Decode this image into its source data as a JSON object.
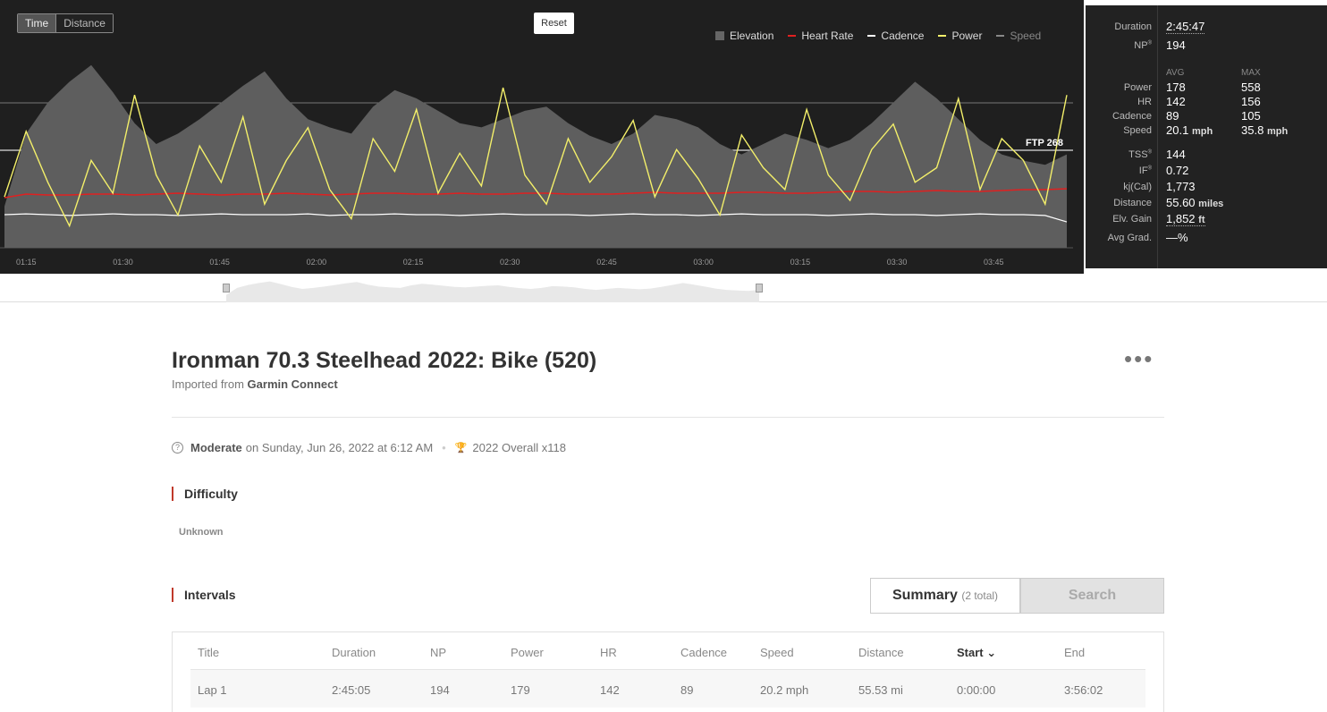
{
  "chart": {
    "toggle": {
      "time": "Time",
      "distance": "Distance"
    },
    "reset_label": "Reset",
    "legend": [
      {
        "label": "Elevation",
        "color": "#666666",
        "kind": "box",
        "enabled": true
      },
      {
        "label": "Heart Rate",
        "color": "#e02020",
        "kind": "line",
        "enabled": true
      },
      {
        "label": "Cadence",
        "color": "#ffffff",
        "kind": "line",
        "enabled": true
      },
      {
        "label": "Power",
        "color": "#f3ef6a",
        "kind": "line",
        "enabled": true
      },
      {
        "label": "Speed",
        "color": "#888888",
        "kind": "line",
        "enabled": false
      }
    ],
    "ftp_label": "FTP 268",
    "x_ticks": [
      "01:15",
      "01:30",
      "01:45",
      "02:00",
      "02:15",
      "02:30",
      "02:45",
      "03:00",
      "03:15",
      "03:30",
      "03:45"
    ]
  },
  "chart_data": {
    "type": "line",
    "x_range": [
      "01:12",
      "03:56"
    ],
    "ftp": 268,
    "series": [
      {
        "name": "Elevation",
        "kind": "area",
        "values": [
          20,
          55,
          70,
          80,
          88,
          75,
          60,
          50,
          55,
          62,
          70,
          78,
          85,
          72,
          62,
          58,
          55,
          68,
          76,
          72,
          66,
          60,
          58,
          62,
          66,
          68,
          60,
          54,
          50,
          55,
          64,
          62,
          58,
          50,
          45,
          50,
          55,
          52,
          48,
          52,
          60,
          70,
          80,
          72,
          62,
          52,
          45,
          42,
          40,
          45
        ]
      },
      {
        "name": "Heart Rate",
        "values": [
          138,
          142,
          141,
          141,
          142,
          142,
          141,
          142,
          143,
          142,
          141,
          142,
          142,
          143,
          142,
          141,
          142,
          143,
          143,
          142,
          142,
          143,
          142,
          142,
          143,
          143,
          142,
          142,
          142,
          143,
          144,
          143,
          143,
          143,
          144,
          144,
          143,
          143,
          144,
          145,
          145,
          144,
          145,
          146,
          145,
          145,
          146,
          147,
          147,
          148
        ]
      },
      {
        "name": "Cadence",
        "values": [
          89,
          90,
          89,
          88,
          89,
          90,
          89,
          89,
          88,
          89,
          90,
          89,
          89,
          89,
          90,
          88,
          89,
          89,
          90,
          89,
          89,
          88,
          89,
          90,
          89,
          89,
          89,
          88,
          89,
          90,
          89,
          89,
          88,
          89,
          90,
          89,
          89,
          89,
          88,
          89,
          90,
          89,
          89,
          88,
          89,
          90,
          89,
          89,
          88,
          80
        ]
      },
      {
        "name": "Power",
        "values": [
          140,
          320,
          180,
          60,
          240,
          150,
          420,
          200,
          90,
          280,
          180,
          360,
          120,
          240,
          330,
          160,
          80,
          300,
          210,
          380,
          150,
          260,
          170,
          440,
          200,
          120,
          300,
          180,
          250,
          350,
          140,
          270,
          190,
          90,
          310,
          220,
          160,
          380,
          200,
          130,
          270,
          340,
          180,
          220,
          410,
          160,
          300,
          240,
          120,
          420
        ]
      }
    ]
  },
  "stats": {
    "duration_label": "Duration",
    "duration_value": "2:45:47",
    "np_label": "NP",
    "np_value": "194",
    "avg_header": "AVG",
    "max_header": "MAX",
    "rows": [
      {
        "label": "Power",
        "avg": "178",
        "max": "558"
      },
      {
        "label": "HR",
        "avg": "142",
        "max": "156"
      },
      {
        "label": "Cadence",
        "avg": "89",
        "max": "105"
      }
    ],
    "speed_label": "Speed",
    "speed_avg": "20.1",
    "speed_max": "35.8",
    "speed_unit": "mph",
    "tss_label": "TSS",
    "tss_value": "144",
    "if_label": "IF",
    "if_value": "0.72",
    "kj_label": "kj(Cal)",
    "kj_value": "1,773",
    "distance_label": "Distance",
    "distance_value": "55.60",
    "distance_unit": "miles",
    "elv_label": "Elv. Gain",
    "elv_value": "1,852",
    "elv_unit": "ft",
    "grad_label": "Avg Grad.",
    "grad_value": "—%"
  },
  "activity": {
    "title": "Ironman 70.3 Steelhead 2022: Bike (520)",
    "imported_prefix": "Imported from",
    "imported_source": "Garmin Connect",
    "more_label": "•••",
    "difficulty_word": "Moderate",
    "date_text": "on Sunday, Jun 26, 2022 at 6:12 AM",
    "ranking": "2022 Overall x118"
  },
  "sections": {
    "difficulty_title": "Difficulty",
    "difficulty_value": "Unknown",
    "intervals_title": "Intervals"
  },
  "tabs": {
    "summary_label": "Summary",
    "summary_count": "(2 total)",
    "search_label": "Search"
  },
  "table": {
    "headers": [
      "Title",
      "Duration",
      "NP",
      "Power",
      "HR",
      "Cadence",
      "Speed",
      "Distance",
      "Start",
      "End"
    ],
    "sorted_indicator": "⌄",
    "rows": [
      [
        "Lap 1",
        "2:45:05",
        "194",
        "179",
        "142",
        "89",
        "20.2 mph",
        "55.53 mi",
        "0:00:00",
        "3:56:02"
      ]
    ]
  }
}
